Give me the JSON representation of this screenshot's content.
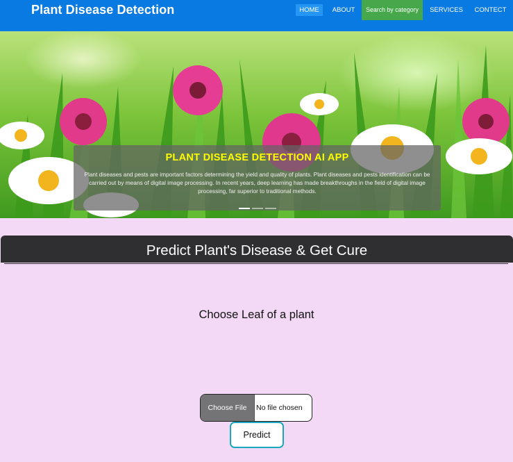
{
  "navbar": {
    "brand": "Plant Disease Detection",
    "items": [
      {
        "label": "HOME"
      },
      {
        "label": "ABOUT"
      },
      {
        "label": "Search by category"
      },
      {
        "label": "SERVICES"
      },
      {
        "label": "CONTECT"
      }
    ],
    "colors": {
      "background": "#0a7ae3",
      "active": "#2596f4",
      "search": "#46a84a"
    }
  },
  "carousel": {
    "title": "PLANT DISEASE DETECTION AI APP",
    "text": "Plant diseases and pests are important factors determining the yield and quality of plants. Plant diseases and pests identification can be carried out by means of digital image processing. In recent years, deep learning has made breakthroughs in the field of digital image processing, far superior to traditional methods.",
    "slide_count": 3,
    "active_slide": 1,
    "colors": {
      "title": "#ffff00"
    }
  },
  "predict": {
    "heading": "Predict Plant's Disease & Get Cure",
    "choose_label": "Choose Leaf of a plant",
    "file_button": "Choose File",
    "file_status": "No file chosen",
    "submit": "Predict",
    "colors": {
      "page_bg": "#f3d9f5",
      "header_bg": "#2f2f31",
      "submit_border": "#1aa7c0"
    }
  }
}
